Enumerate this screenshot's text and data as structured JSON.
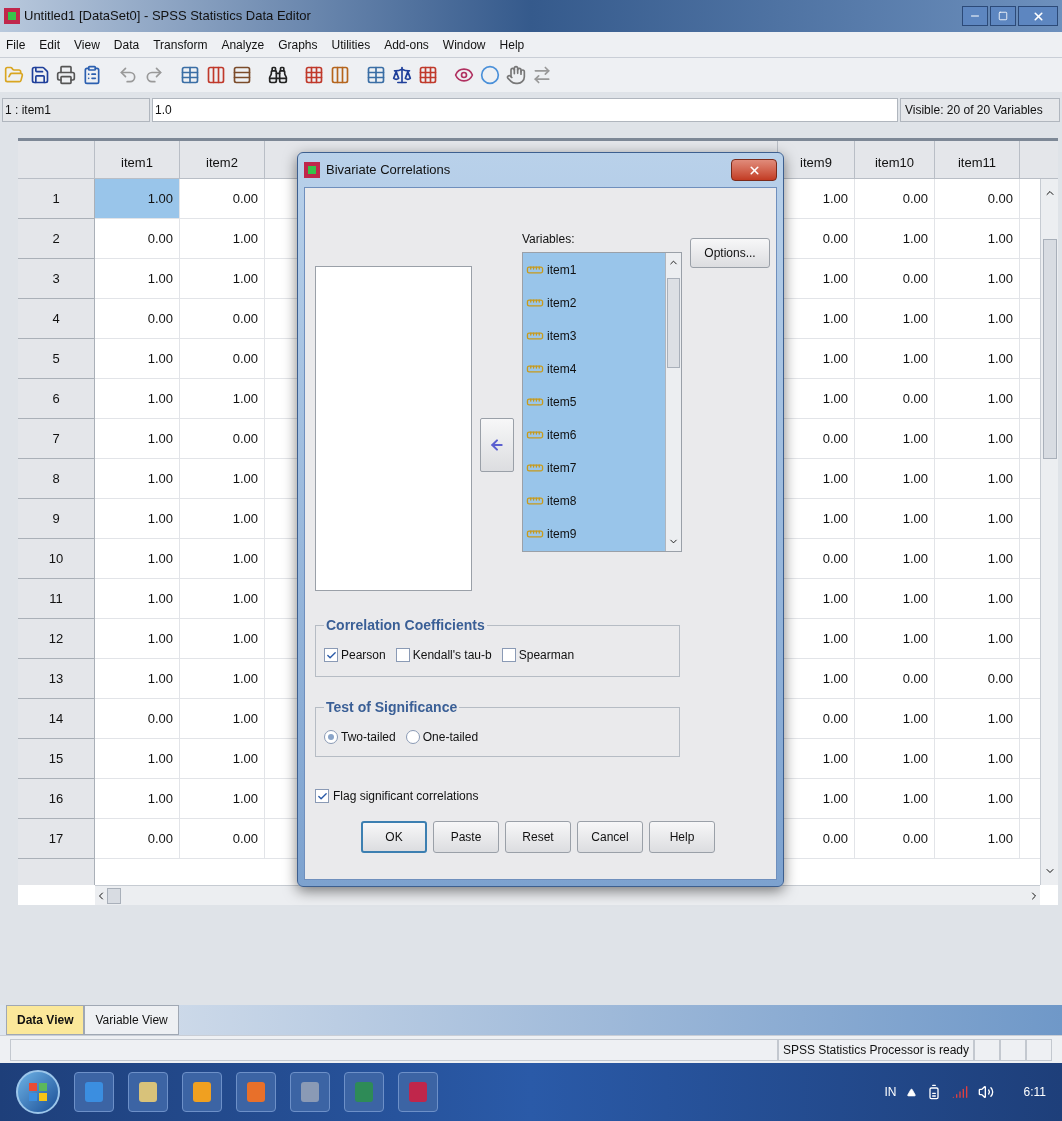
{
  "window": {
    "title": "Untitled1 [DataSet0] - SPSS Statistics Data Editor"
  },
  "menu": [
    "File",
    "Edit",
    "View",
    "Data",
    "Transform",
    "Analyze",
    "Graphs",
    "Utilities",
    "Add-ons",
    "Window",
    "Help"
  ],
  "cell_editor": {
    "cell": "1 : item1",
    "value": "1.0",
    "visible": "Visible: 20 of 20 Variables"
  },
  "grid": {
    "columns": [
      "item1",
      "item2",
      "item9",
      "item10",
      "item11"
    ],
    "rows": [
      {
        "number": "1",
        "selected": true,
        "cells": [
          "1.00",
          "0.00",
          "1.00",
          "0.00",
          "0.00"
        ]
      },
      {
        "number": "2",
        "selected": false,
        "cells": [
          "0.00",
          "1.00",
          "0.00",
          "1.00",
          "1.00"
        ]
      },
      {
        "number": "3",
        "selected": false,
        "cells": [
          "1.00",
          "1.00",
          "1.00",
          "0.00",
          "1.00"
        ]
      },
      {
        "number": "4",
        "selected": false,
        "cells": [
          "0.00",
          "0.00",
          "1.00",
          "1.00",
          "1.00"
        ]
      },
      {
        "number": "5",
        "selected": false,
        "cells": [
          "1.00",
          "0.00",
          "1.00",
          "1.00",
          "1.00"
        ]
      },
      {
        "number": "6",
        "selected": false,
        "cells": [
          "1.00",
          "1.00",
          "1.00",
          "0.00",
          "1.00"
        ]
      },
      {
        "number": "7",
        "selected": false,
        "cells": [
          "1.00",
          "0.00",
          "0.00",
          "1.00",
          "1.00"
        ]
      },
      {
        "number": "8",
        "selected": false,
        "cells": [
          "1.00",
          "1.00",
          "1.00",
          "1.00",
          "1.00"
        ]
      },
      {
        "number": "9",
        "selected": false,
        "cells": [
          "1.00",
          "1.00",
          "1.00",
          "1.00",
          "1.00"
        ]
      },
      {
        "number": "10",
        "selected": false,
        "cells": [
          "1.00",
          "1.00",
          "0.00",
          "1.00",
          "1.00"
        ]
      },
      {
        "number": "11",
        "selected": false,
        "cells": [
          "1.00",
          "1.00",
          "1.00",
          "1.00",
          "1.00"
        ]
      },
      {
        "number": "12",
        "selected": false,
        "cells": [
          "1.00",
          "1.00",
          "1.00",
          "1.00",
          "1.00"
        ]
      },
      {
        "number": "13",
        "selected": false,
        "cells": [
          "1.00",
          "1.00",
          "1.00",
          "0.00",
          "0.00"
        ]
      },
      {
        "number": "14",
        "selected": false,
        "cells": [
          "0.00",
          "1.00",
          "0.00",
          "1.00",
          "1.00"
        ]
      },
      {
        "number": "15",
        "selected": false,
        "cells": [
          "1.00",
          "1.00",
          "1.00",
          "1.00",
          "1.00"
        ]
      },
      {
        "number": "16",
        "selected": false,
        "cells": [
          "1.00",
          "1.00",
          "1.00",
          "1.00",
          "1.00"
        ]
      },
      {
        "number": "17",
        "selected": false,
        "cells": [
          "0.00",
          "0.00",
          "0.00",
          "0.00",
          "1.00"
        ]
      }
    ]
  },
  "tabs": [
    {
      "label": "Data View",
      "selected": true
    },
    {
      "label": "Variable View",
      "selected": false
    }
  ],
  "status_bar": {
    "text": "SPSS Statistics  Processor is ready"
  },
  "dialog": {
    "title": "Bivariate Correlations",
    "variables_label": "Variables:",
    "variables": [
      {
        "name": "item1",
        "selected": true
      },
      {
        "name": "item2",
        "selected": true
      },
      {
        "name": "item3",
        "selected": true
      },
      {
        "name": "item4",
        "selected": true
      },
      {
        "name": "item5",
        "selected": true
      },
      {
        "name": "item6",
        "selected": true
      },
      {
        "name": "item7",
        "selected": true
      },
      {
        "name": "item8",
        "selected": true
      },
      {
        "name": "item9",
        "selected": true
      }
    ],
    "options_button": "Options...",
    "correlation_coefficients": {
      "title": "Correlation Coefficients",
      "options": [
        {
          "label": "Pearson",
          "checked": true
        },
        {
          "label": "Kendall's tau-b",
          "checked": false
        },
        {
          "label": "Spearman",
          "checked": false
        }
      ]
    },
    "test_of_significance": {
      "title": "Test of Significance",
      "options": [
        {
          "label": "Two-tailed",
          "selected": true
        },
        {
          "label": "One-tailed",
          "selected": false
        }
      ]
    },
    "flag": {
      "label": "Flag significant correlations",
      "checked": true
    },
    "buttons": [
      {
        "label": "OK",
        "default": true
      },
      {
        "label": "Paste",
        "default": false
      },
      {
        "label": "Reset",
        "default": false
      },
      {
        "label": "Cancel",
        "default": false
      },
      {
        "label": "Help",
        "default": false
      }
    ]
  },
  "taskbar": {
    "language": "IN",
    "time": "6:11"
  }
}
